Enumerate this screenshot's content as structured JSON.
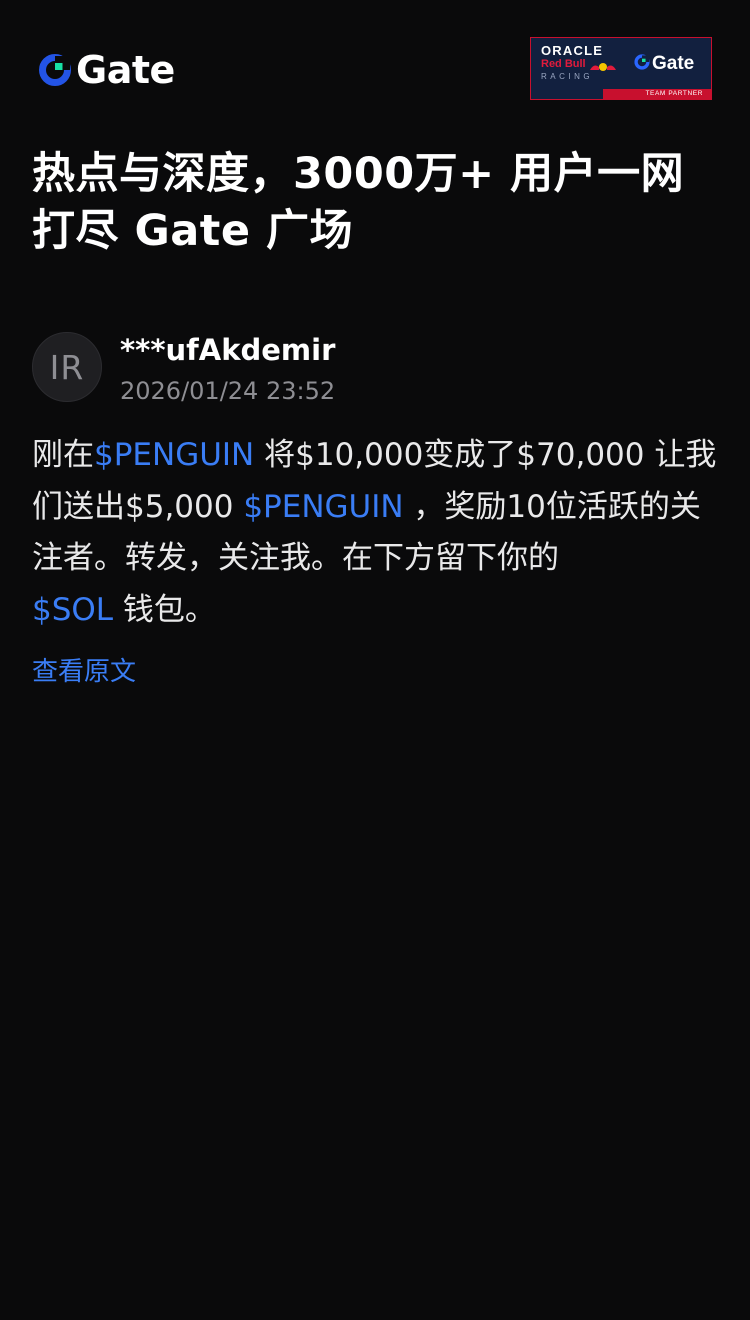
{
  "brand": {
    "name": "Gate",
    "logo_icon": "gate-logo-icon",
    "accent": "#2354e6",
    "accent_green": "#17e0a5"
  },
  "partner_badge": {
    "oracle": "ORACLE",
    "redbull": "Red Bull",
    "racing": "RACING",
    "gate": "Gate",
    "caption": "TEAM PARTNER",
    "border_color": "#c8102e",
    "bg_color": "#12203f"
  },
  "headline": "热点与深度，3000万+ 用户一网打尽 Gate 广场",
  "post": {
    "avatar_initials": "IR",
    "author": "***ufAkdemir",
    "time": "2026/01/24 23:52",
    "body": {
      "p1": "刚在",
      "tag1": "$PENGUIN",
      "p2": " 将$10,000变成了$70,000 让我们送出$5,000 ",
      "tag2": "$PENGUIN",
      "p3": " ，奖励10位活跃的关注者。转发，关注我。在下方留下你的",
      "tag3": "$SOL",
      "p4": " 钱包。"
    },
    "view_original": "查看原文",
    "link_color": "#3a7df5"
  },
  "background": "#0a0a0b"
}
